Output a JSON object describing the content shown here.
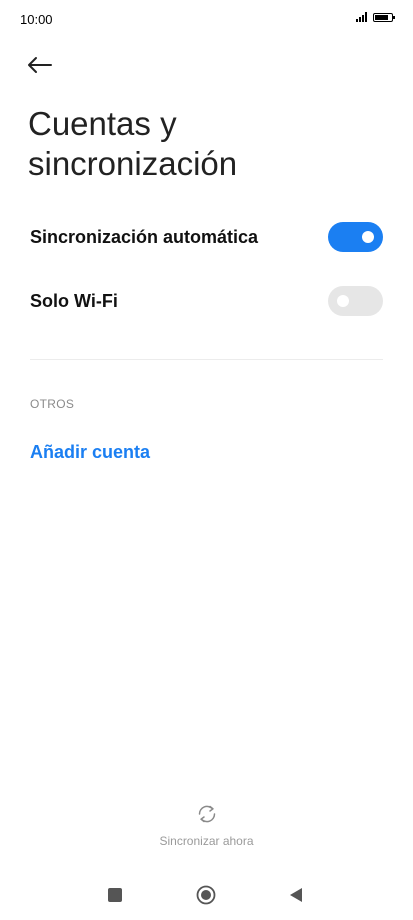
{
  "status_bar": {
    "time": "10:00",
    "battery_level": 0.95
  },
  "header": {
    "back_icon": "arrow-left-icon",
    "title": "Cuentas y sincronización"
  },
  "settings": [
    {
      "label": "Sincronización automática",
      "enabled": true
    },
    {
      "label": "Solo Wi-Fi",
      "enabled": false
    }
  ],
  "others": {
    "section_label": "OTROS",
    "add_account_label": "Añadir cuenta"
  },
  "sync_now": {
    "icon": "sync-icon",
    "label": "Sincronizar ahora"
  },
  "nav": {
    "recents_icon": "square-icon",
    "home_icon": "circle-icon",
    "back_icon": "triangle-back-icon"
  },
  "colors": {
    "accent": "#1b7ff2",
    "toggle_off": "#e6e6e6",
    "secondary_text": "#8a8a8a"
  }
}
